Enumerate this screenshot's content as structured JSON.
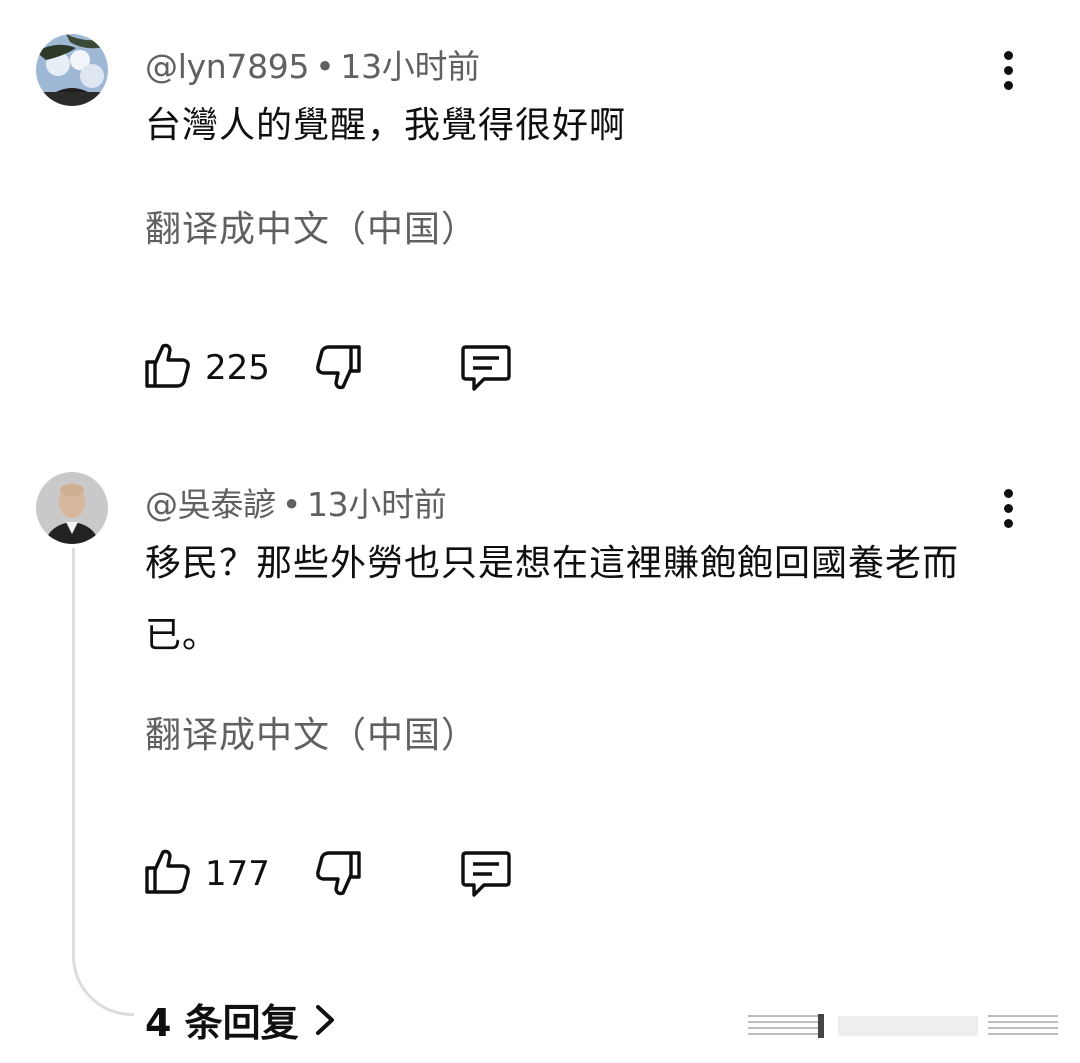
{
  "comments": [
    {
      "author": "@lyn7895",
      "separator": "•",
      "time": "13小时前",
      "text": "台灣人的覺醒，我覺得很好啊",
      "translate_label": "翻译成中文（中国）",
      "likes": "225"
    },
    {
      "author": "@吳泰諺",
      "separator": "•",
      "time": "13小时前",
      "text": "移民？那些外勞也只是想在這裡賺飽飽回國養老而已。",
      "translate_label": "翻译成中文（中国）",
      "likes": "177"
    }
  ],
  "replies": {
    "label": "4 条回复",
    "chevron": "chevron-right-icon"
  },
  "icons": {
    "like": "thumb-up-icon",
    "dislike": "thumb-down-icon",
    "reply": "comment-icon",
    "more": "more-vertical-icon"
  },
  "colors": {
    "text": "#0f0f0f",
    "secondary": "#606060",
    "thread_line": "#dddddd"
  }
}
